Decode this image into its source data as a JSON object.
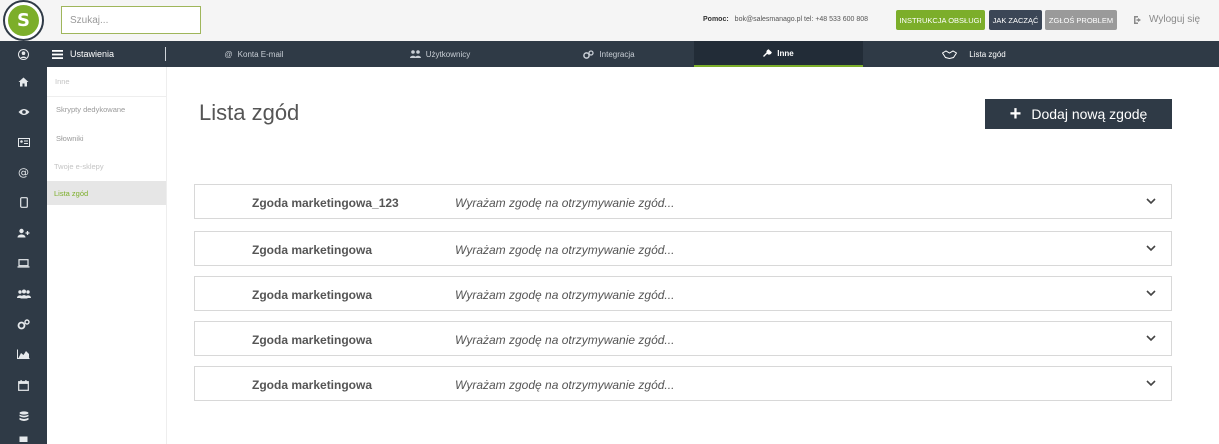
{
  "top": {
    "logo_letter": "S",
    "search_placeholder": "Szukaj...",
    "help_label": "Pomoc:",
    "help_contact": "bok@salesmanago.pl tel: +48 533 600 808",
    "btn_manual": "INSTRUKCJA OBSŁUGI",
    "btn_start": "JAK ZACZĄĆ",
    "btn_report": "ZGŁOŚ PROBLEM",
    "logout": "Wyloguj się"
  },
  "nav": {
    "settings": "Ustawienia",
    "tabs": [
      {
        "label": "Konta E-mail",
        "icon": "at-icon"
      },
      {
        "label": "Użytkownicy",
        "icon": "users-icon"
      },
      {
        "label": "Integracja",
        "icon": "gears-icon"
      },
      {
        "label": "Inne",
        "icon": "wrench-icon"
      },
      {
        "label": "Lista zgód",
        "icon": "handshake-icon"
      }
    ]
  },
  "sidebar": {
    "items": [
      {
        "label": "Inne"
      },
      {
        "label": "Skrypty dedykowane"
      },
      {
        "label": "Słowniki"
      },
      {
        "label": "Twoje e-sklepy"
      },
      {
        "label": "Lista zgód"
      }
    ]
  },
  "main": {
    "title": "Lista zgód",
    "add_button": "Dodaj nową zgodę",
    "rows": [
      {
        "name": "Zgoda marketingowa_123",
        "desc": "Wyrażam zgodę na otrzymywanie zgód..."
      },
      {
        "name": "Zgoda marketingowa",
        "desc": "Wyrażam zgodę na otrzymywanie zgód..."
      },
      {
        "name": "Zgoda marketingowa",
        "desc": "Wyrażam zgodę na otrzymywanie zgód..."
      },
      {
        "name": "Zgoda marketingowa",
        "desc": "Wyrażam zgodę na otrzymywanie zgód..."
      },
      {
        "name": "Zgoda marketingowa",
        "desc": "Wyrażam zgodę na otrzymywanie zgód..."
      }
    ]
  },
  "colors": {
    "brand_green": "#7cae2a",
    "navy": "#2f3a46"
  }
}
